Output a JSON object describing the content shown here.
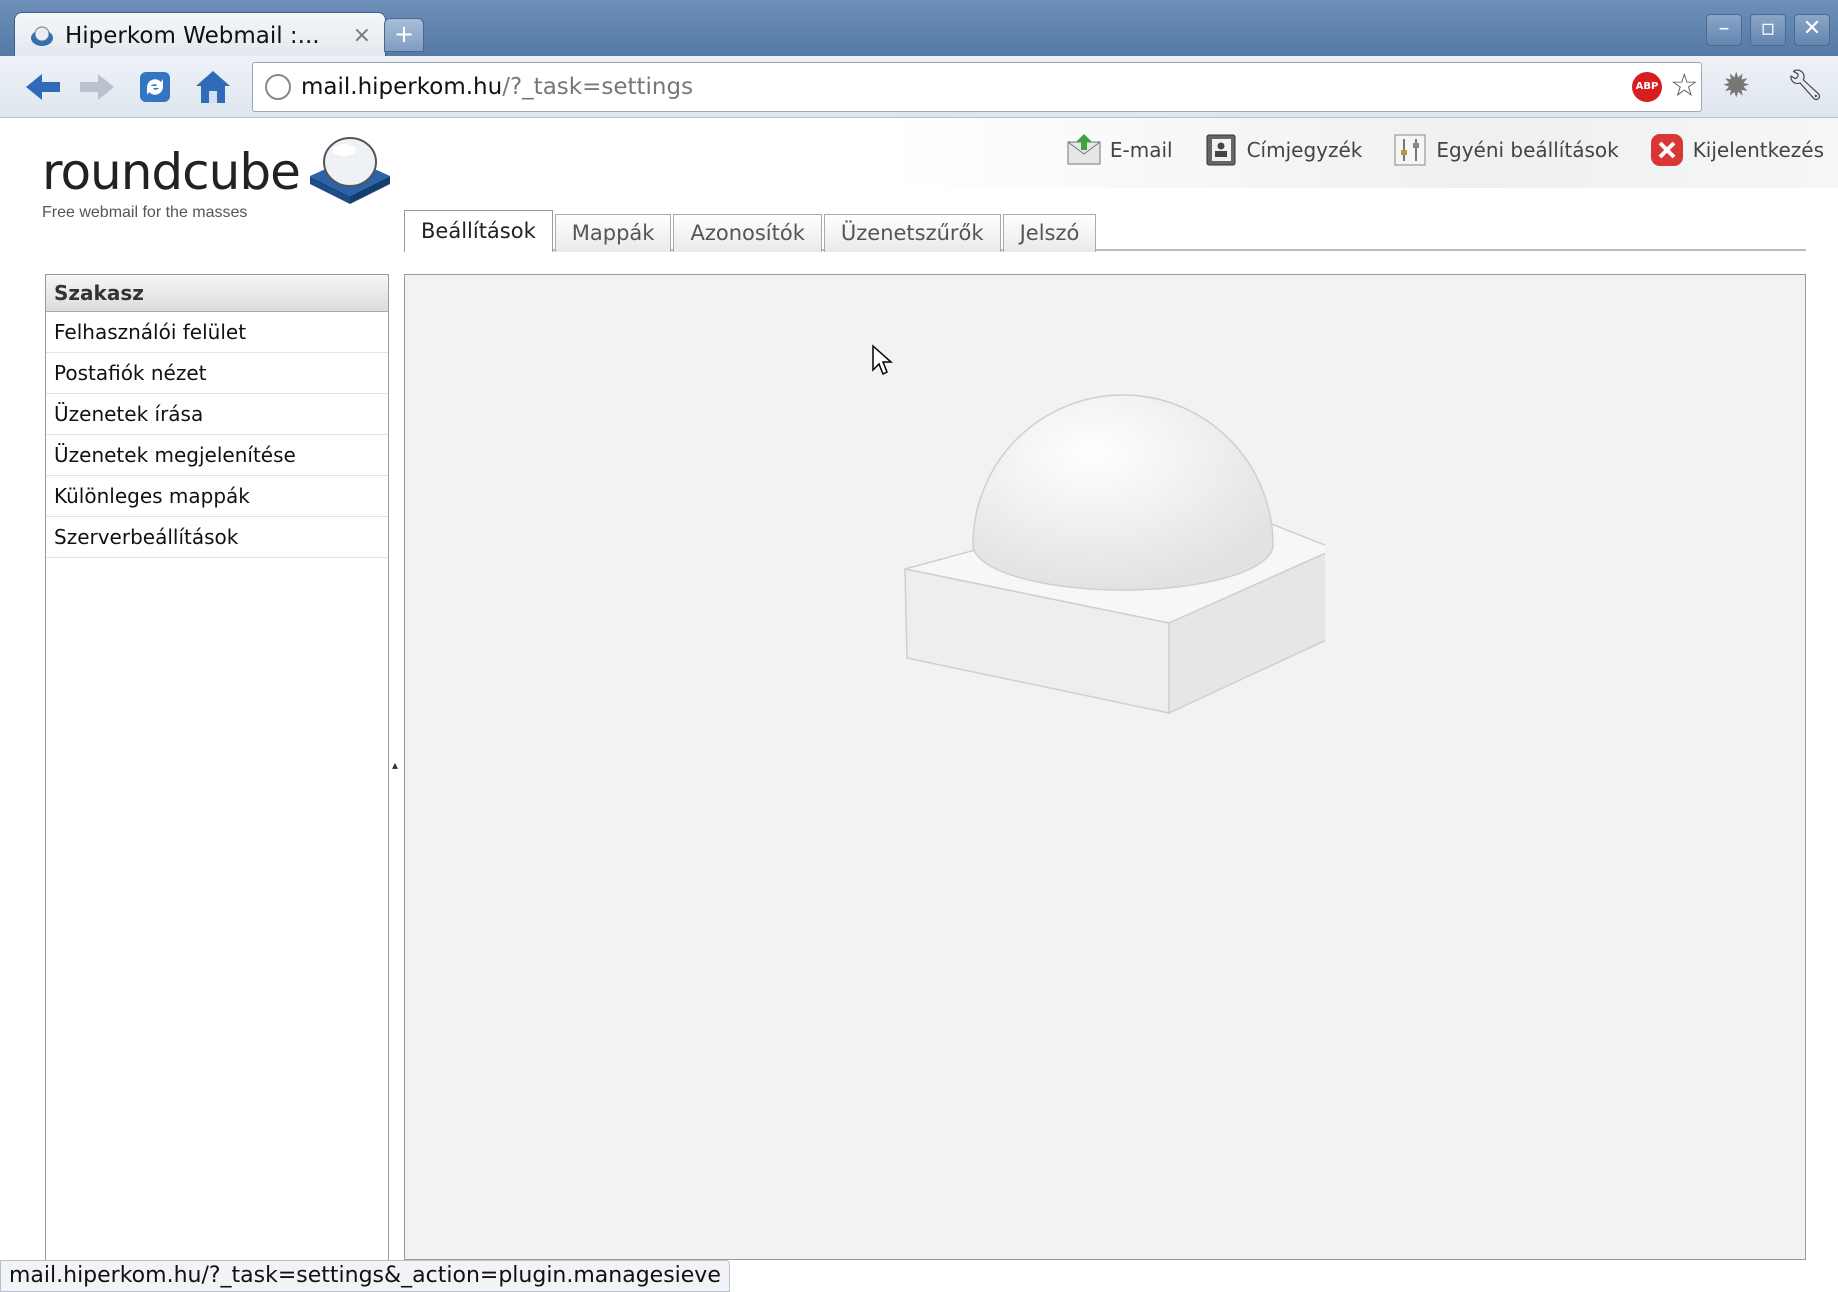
{
  "browser": {
    "tab_title": "Hiperkom Webmail :...",
    "tab_close": "×",
    "new_tab": "+",
    "window_controls": {
      "minimize": "–",
      "restore": "▫",
      "close": "✕"
    },
    "url_host": "mail.hiperkom.hu",
    "url_path": "/?_task=settings",
    "adblock_label": "ABP",
    "icons": [
      "back-icon",
      "forward-icon",
      "reload-icon",
      "home-icon",
      "globe-icon",
      "adblock-icon",
      "star-icon",
      "gear-icon",
      "wrench-icon"
    ]
  },
  "header": {
    "logo_word": "roundcube",
    "logo_tagline": "Free webmail for the masses",
    "nav": [
      {
        "label": "E-mail",
        "icon": "email-icon"
      },
      {
        "label": "Címjegyzék",
        "icon": "addressbook-icon"
      },
      {
        "label": "Egyéni beállítások",
        "icon": "settings-icon"
      },
      {
        "label": "Kijelentkezés",
        "icon": "logout-icon"
      }
    ]
  },
  "tabs": [
    {
      "label": "Beállítások",
      "active": true
    },
    {
      "label": "Mappák",
      "active": false
    },
    {
      "label": "Azonosítók",
      "active": false
    },
    {
      "label": "Üzenetszűrők",
      "active": false
    },
    {
      "label": "Jelszó",
      "active": false
    }
  ],
  "sidebar": {
    "heading": "Szakasz",
    "items": [
      "Felhasználói felület",
      "Postafiók nézet",
      "Üzenetek írása",
      "Üzenetek megjelenítése",
      "Különleges mappák",
      "Szerverbeállítások"
    ]
  },
  "status_bar": "mail.hiperkom.hu/?_task=settings&_action=plugin.managesieve",
  "colors": {
    "titlebar": "#6d8fb8",
    "logout_red": "#d93636",
    "content_bg": "#f2f2f2"
  }
}
